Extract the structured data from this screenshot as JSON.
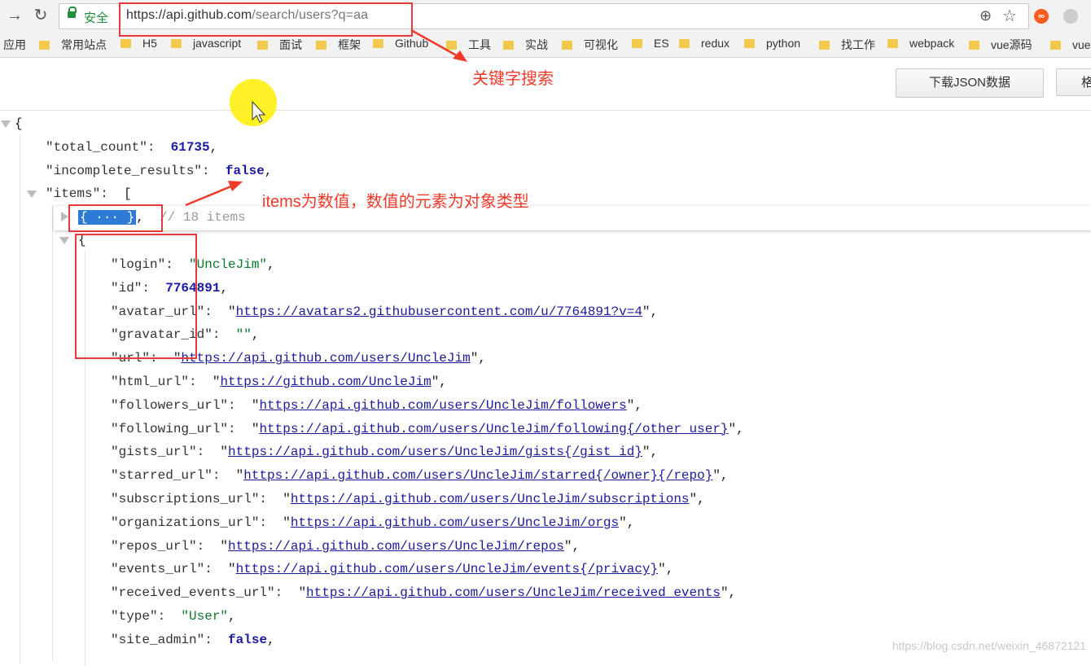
{
  "browser": {
    "secure_label": "安全",
    "url_host": "https://api.github.com",
    "url_path": "/search/users?q=aa",
    "bookmarks": [
      "应用",
      "常用站点",
      "H5",
      "javascript",
      "面试",
      "框架",
      "Github",
      "工具",
      "实战",
      "可视化",
      "ES",
      "redux",
      "python",
      "找工作",
      "webpack",
      "vue源码",
      "vue项"
    ]
  },
  "toolbar": {
    "download_label": "下载JSON数据",
    "second_label": "格"
  },
  "annotations": {
    "url_note": "关键字搜索",
    "items_note": "items为数值，数值的元素为对象类型"
  },
  "json": {
    "open_brace": "{",
    "total_count_key": "\"total_count\":",
    "total_count_val": "61735",
    "incomplete_key": "\"incomplete_results\":",
    "incomplete_val": "false",
    "items_key": "\"items\":",
    "items_open": "[",
    "collapsed_text": "{ ··· }",
    "collapsed_comment": "// 18 items",
    "obj_open": "{",
    "fields": [
      {
        "key": "\"login\":",
        "val": "\"UncleJim\"",
        "type": "str"
      },
      {
        "key": "\"id\":",
        "val": "7764891",
        "type": "num"
      },
      {
        "key": "\"avatar_url\":",
        "val": "https://avatars2.githubusercontent.com/u/7764891?v=4",
        "type": "link"
      },
      {
        "key": "\"gravatar_id\":",
        "val": "\"\"",
        "type": "str"
      },
      {
        "key": "\"url\":",
        "val": "https://api.github.com/users/UncleJim",
        "type": "link"
      },
      {
        "key": "\"html_url\":",
        "val": "https://github.com/UncleJim",
        "type": "link"
      },
      {
        "key": "\"followers_url\":",
        "val": "https://api.github.com/users/UncleJim/followers",
        "type": "link"
      },
      {
        "key": "\"following_url\":",
        "val": "https://api.github.com/users/UncleJim/following{/other_user}",
        "type": "link"
      },
      {
        "key": "\"gists_url\":",
        "val": "https://api.github.com/users/UncleJim/gists{/gist_id}",
        "type": "link"
      },
      {
        "key": "\"starred_url\":",
        "val": "https://api.github.com/users/UncleJim/starred{/owner}{/repo}",
        "type": "link"
      },
      {
        "key": "\"subscriptions_url\":",
        "val": "https://api.github.com/users/UncleJim/subscriptions",
        "type": "link"
      },
      {
        "key": "\"organizations_url\":",
        "val": "https://api.github.com/users/UncleJim/orgs",
        "type": "link"
      },
      {
        "key": "\"repos_url\":",
        "val": "https://api.github.com/users/UncleJim/repos",
        "type": "link"
      },
      {
        "key": "\"events_url\":",
        "val": "https://api.github.com/users/UncleJim/events{/privacy}",
        "type": "link"
      },
      {
        "key": "\"received_events_url\":",
        "val": "https://api.github.com/users/UncleJim/received_events",
        "type": "link"
      },
      {
        "key": "\"type\":",
        "val": "\"User\"",
        "type": "str"
      },
      {
        "key": "\"site_admin\":",
        "val": "false",
        "type": "bool"
      }
    ]
  },
  "watermark": "https://blog.csdn.net/weixin_46872121",
  "colors": {
    "annotation": "#f23a2a",
    "secure": "#1e8e3e",
    "number": "#1a1aa6",
    "link": "#1a1a9c"
  }
}
